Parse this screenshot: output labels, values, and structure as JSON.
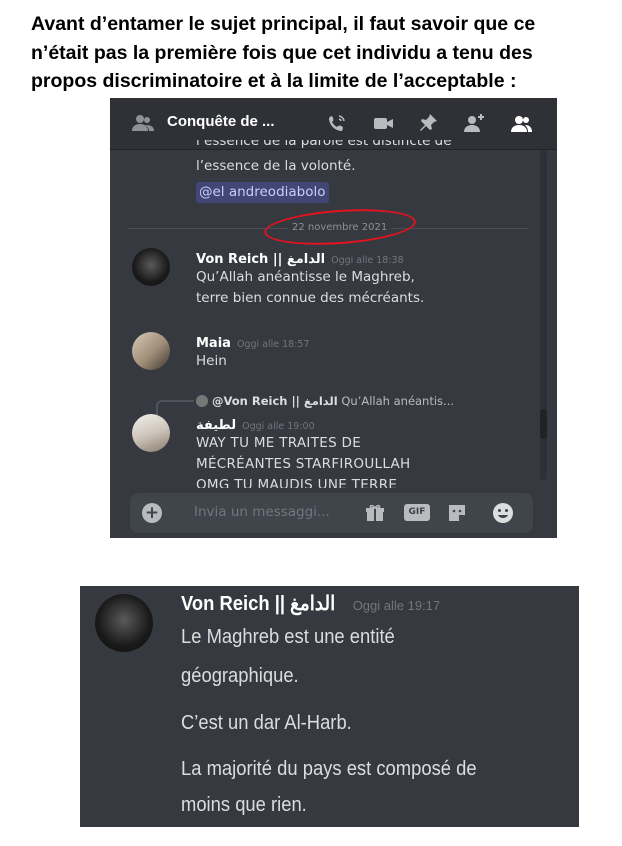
{
  "intro": {
    "line1": "Avant d’entamer le sujet principal, il faut savoir que ce",
    "line2": "n’était pas la première fois que cet individu a tenu des",
    "line3": "propos discriminatoire et à la limite de l’acceptable :"
  },
  "screenshot1": {
    "channel_title": "Conquête de ...",
    "top_icons": [
      "people-icon",
      "call-icon",
      "video-icon",
      "pin-icon",
      "add-member-icon",
      "members-icon"
    ],
    "prev_message_cut": "l’essence de la parole est distincte de",
    "prev_message_line": "l’essence de la volonté.",
    "mention": "@el andreodiabolo",
    "date_separator": "22 novembre 2021",
    "messages": [
      {
        "author": "Von Reich || الدامغ",
        "time": "Oggi alle 18:38",
        "lines": [
          "Qu’Allah anéantisse le Maghreb,",
          "terre bien connue des mécréants."
        ]
      },
      {
        "author": "Maia",
        "time": "Oggi alle 18:57",
        "lines": [
          "Hein"
        ]
      },
      {
        "reply_author": "@Von Reich || الدامغ",
        "reply_text": "Qu’Allah anéantis...",
        "author": "لطيفة",
        "time": "Oggi alle 19:00",
        "lines": [
          "WAY TU ME TRAITES DE",
          "MÉCRÉANTES STARFIROULLAH",
          "OMG TU MAUDIS UNE TERRE"
        ]
      }
    ],
    "composer_placeholder": "Invia un messaggi...",
    "gif_label": "GIF"
  },
  "screenshot2": {
    "author": "Von Reich || الدامغ",
    "time": "Oggi alle 19:17",
    "lines": [
      "Le Maghreb est une entité",
      "géographique.",
      "C’est un dar Al-Harb.",
      "La majorité du pays est composé de",
      "moins que rien."
    ]
  }
}
